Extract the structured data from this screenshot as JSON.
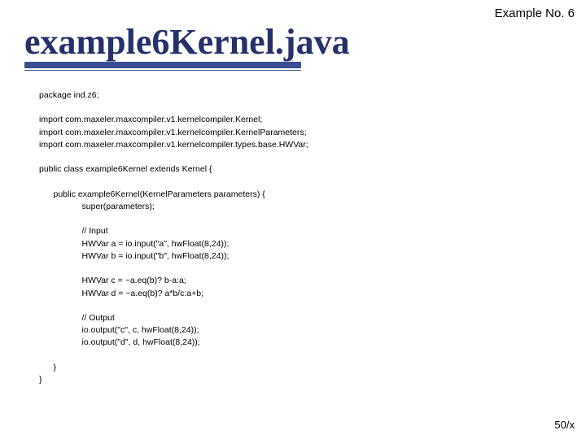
{
  "header": {
    "label": "Example No. 6"
  },
  "title": {
    "text": "example6Kernel.java"
  },
  "code": {
    "l01": "package ind.z6;",
    "l02": "",
    "l03": "import com.maxeler.maxcompiler.v1.kernelcompiler.Kernel;",
    "l04": "import com.maxeler.maxcompiler.v1.kernelcompiler.KernelParameters;",
    "l05": "import com.maxeler.maxcompiler.v1.kernelcompiler.types.base.HWVar;",
    "l06": "",
    "l07": "public class example6Kernel extends Kernel {",
    "l08": "",
    "l09": "      public example6Kernel(KernelParameters parameters) {",
    "l10": "                  super(parameters);",
    "l11": "",
    "l12": "                  // Input",
    "l13": "                  HWVar a = io.input(\"a\", hwFloat(8,24));",
    "l14": "                  HWVar b = io.input(\"b\", hwFloat(8,24));",
    "l15": "",
    "l16": "                  HWVar c = ~a.eq(b)? b-a:a;",
    "l17": "                  HWVar d = ~a.eq(b)? a*b/c:a+b;",
    "l18": "",
    "l19": "                  // Output",
    "l20": "                  io.output(\"c\", c, hwFloat(8,24));",
    "l21": "                  io.output(\"d\", d, hwFloat(8,24));",
    "l22": "",
    "l23": "      }",
    "l24": "}"
  },
  "footer": {
    "text": "50/x"
  }
}
